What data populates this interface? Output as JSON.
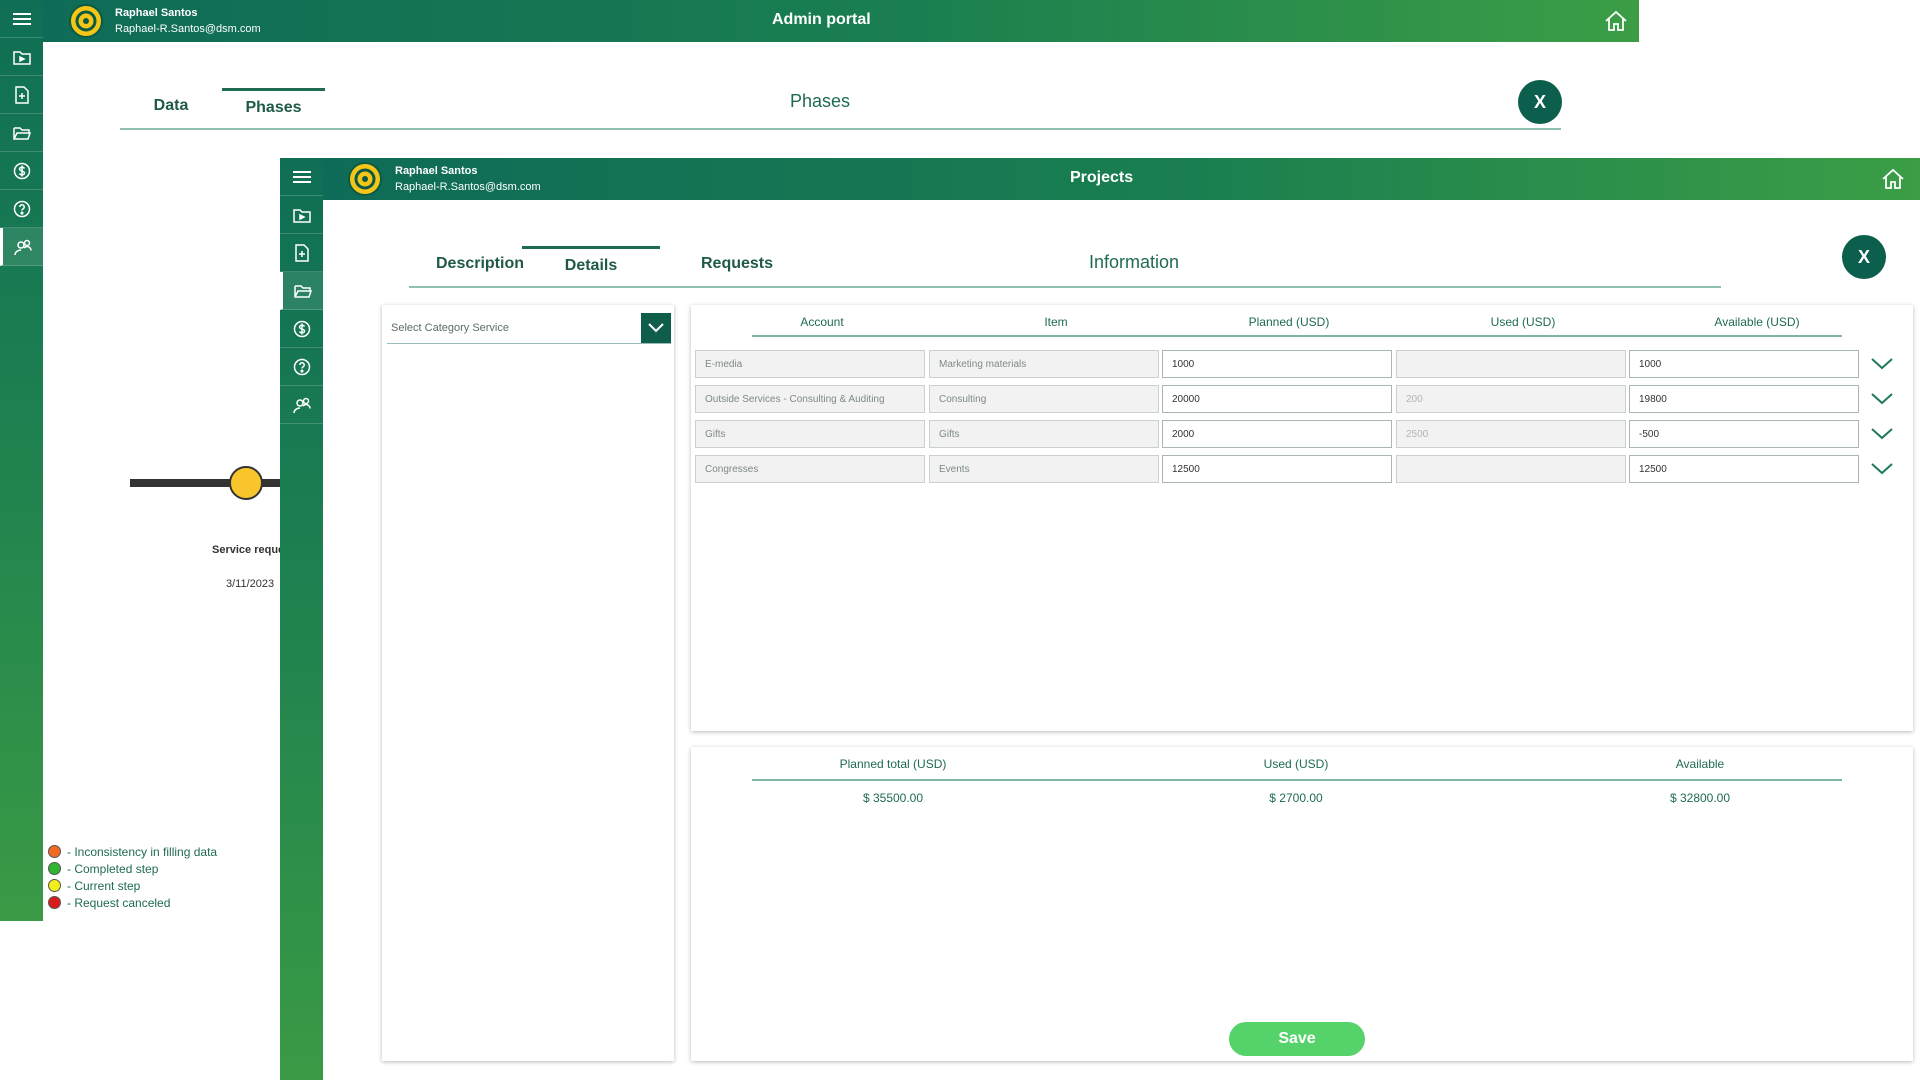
{
  "admin": {
    "user": {
      "name": "Raphael Santos",
      "email": "Raphael-R.Santos@dsm.com"
    },
    "title": "Admin portal",
    "tabs": [
      {
        "label": "Data"
      },
      {
        "label": "Phases"
      }
    ],
    "heading": "Phases",
    "close_label": "X",
    "timeline": {
      "label": "Service reques",
      "date": "3/11/2023"
    },
    "sidebar_icons": [
      "menu-icon",
      "folder-play-icon",
      "document-icon",
      "folder-open-icon",
      "dollar-icon",
      "help-icon",
      "users-icon"
    ],
    "legend": [
      {
        "label": "- Inconsistency in filling data",
        "color": "#f06a24"
      },
      {
        "label": "- Completed step",
        "color": "#2fb532"
      },
      {
        "label": "- Current step",
        "color": "#f2ee1a"
      },
      {
        "label": "- Request canceled",
        "color": "#d81b1b"
      }
    ]
  },
  "projects": {
    "user": {
      "name": "Raphael Santos",
      "email": "Raphael-R.Santos@dsm.com"
    },
    "title": "Projects",
    "tabs": [
      {
        "label": "Description"
      },
      {
        "label": "Details"
      },
      {
        "label": "Requests"
      }
    ],
    "heading": "Information",
    "close_label": "X",
    "select_placeholder": "Select Category Service",
    "table": {
      "headers": [
        "Account",
        "Item",
        "Planned (USD)",
        "Used (USD)",
        "Available (USD)"
      ],
      "rows": [
        {
          "account": "E-media",
          "item": "Marketing materials",
          "planned": "1000",
          "used": "",
          "available": "1000"
        },
        {
          "account": "Outside Services - Consulting & Auditing",
          "item": "Consulting",
          "planned": "20000",
          "used": "200",
          "available": "19800"
        },
        {
          "account": "Gifts",
          "item": "Gifts",
          "planned": "2000",
          "used": "2500",
          "available": "-500"
        },
        {
          "account": "Congresses",
          "item": "Events",
          "planned": "12500",
          "used": "",
          "available": "12500"
        }
      ]
    },
    "summary": {
      "headers": [
        "Planned total (USD)",
        "Used (USD)",
        "Available"
      ],
      "values": [
        "$ 35500.00",
        "$ 2700.00",
        "$ 32800.00"
      ]
    },
    "save_label": "Save",
    "colors": {
      "brand_dark": "#0e6b57",
      "brand_light": "#3c9d46",
      "save": "#55d36a",
      "accent_avatar": "#f5c518"
    }
  }
}
